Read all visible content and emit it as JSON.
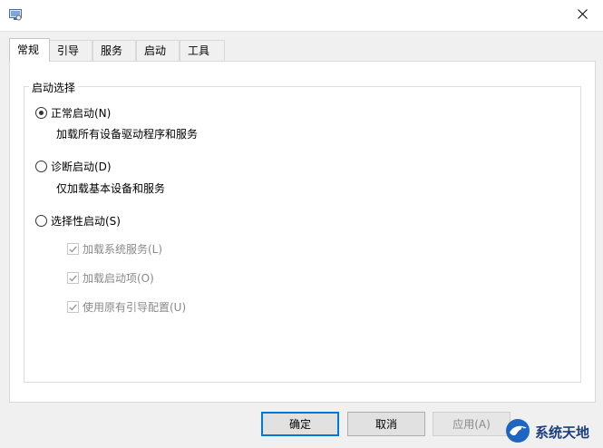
{
  "window": {
    "icon": "system-config-icon",
    "close_icon": "close-icon"
  },
  "tabs": [
    {
      "label": "常规",
      "active": true
    },
    {
      "label": "引导",
      "active": false
    },
    {
      "label": "服务",
      "active": false
    },
    {
      "label": "启动",
      "active": false
    },
    {
      "label": "工具",
      "active": false
    }
  ],
  "startup_selection": {
    "group_title": "启动选择",
    "normal": {
      "label": "正常启动(N)",
      "description": "加载所有设备驱动程序和服务",
      "selected": true
    },
    "diagnostic": {
      "label": "诊断启动(D)",
      "description": "仅加载基本设备和服务",
      "selected": false
    },
    "selective": {
      "label": "选择性启动(S)",
      "selected": false,
      "options": [
        {
          "label": "加载系统服务(L)",
          "checked": true,
          "enabled": false
        },
        {
          "label": "加载启动项(O)",
          "checked": true,
          "enabled": false
        },
        {
          "label": "使用原有引导配置(U)",
          "checked": true,
          "enabled": false
        }
      ]
    }
  },
  "buttons": {
    "ok": "确定",
    "cancel": "取消",
    "apply": "应用(A)"
  },
  "watermark": {
    "text": "系统天地",
    "icon": "bird-logo-icon"
  },
  "colors": {
    "accent": "#0078d7",
    "left_strip": "#1f6fb3",
    "disabled_text": "#8a8a8a",
    "watermark_text": "#1c3f7c"
  }
}
